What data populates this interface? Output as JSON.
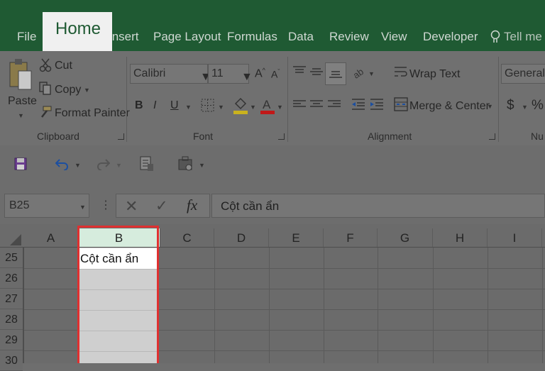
{
  "tabs": [
    "File",
    "Home",
    "Insert",
    "Page Layout",
    "Formulas",
    "Data",
    "Review",
    "View",
    "Developer"
  ],
  "tell_me": "Tell me w",
  "ribbon": {
    "paste_label": "Paste",
    "cut_label": "Cut",
    "copy_label": "Copy",
    "format_painter_label": "Format Painter",
    "clipboard_label": "Clipboard",
    "font_name": "Calibri",
    "font_size": "11",
    "font_label": "Font",
    "bold": "B",
    "italic": "I",
    "underline": "U",
    "wrap_text_label": "Wrap Text",
    "merge_center_label": "Merge & Center",
    "alignment_label": "Alignment",
    "number_format": "General",
    "currency": "$",
    "percent": "%",
    "number_label": "Nu"
  },
  "formula_bar": {
    "name_box": "B25",
    "fx": "fx",
    "content": "Cột cần ẩn"
  },
  "columns": [
    "A",
    "B",
    "C",
    "D",
    "E",
    "F",
    "G",
    "H",
    "I"
  ],
  "rows": [
    "25",
    "26",
    "27",
    "28",
    "29",
    "30"
  ],
  "cell_b25": "Cột cần ẩn",
  "colors": {
    "accent": "#1f5a33",
    "highlight": "#e03030",
    "selected_header": "#d6ecdd"
  }
}
